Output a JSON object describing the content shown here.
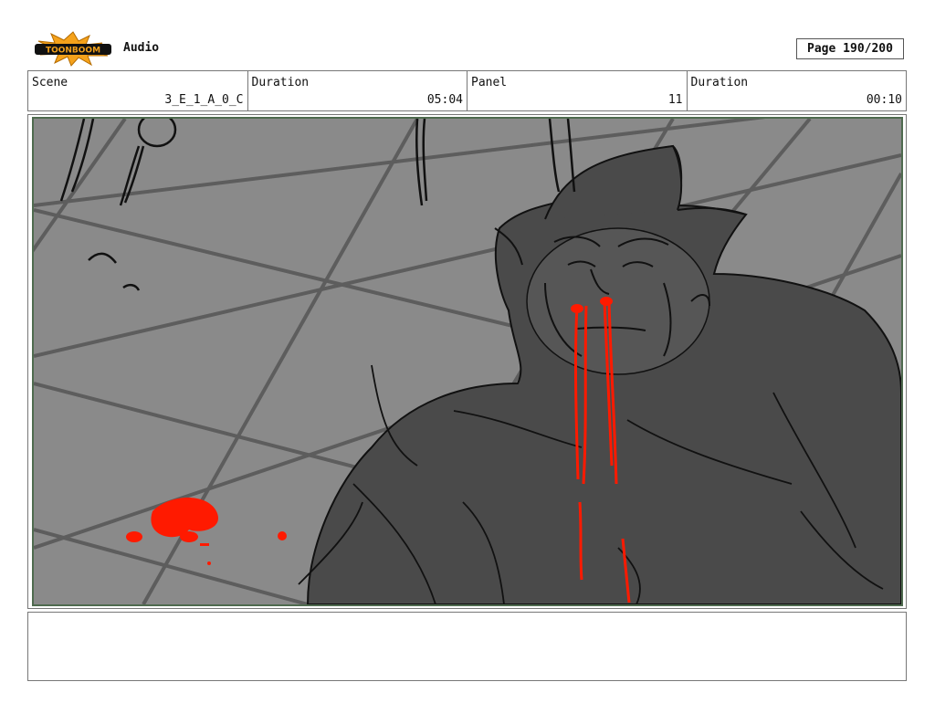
{
  "header": {
    "logo_text": "TOONBOOM",
    "audio_label": "Audio",
    "page_label": "Page 190/200"
  },
  "info": {
    "scene_label": "Scene",
    "scene_value": "3_E_1_A_0_C",
    "duration_label": "Duration",
    "duration_value": "05:04",
    "panel_label": "Panel",
    "panel_value": "11",
    "panel_duration_label": "Duration",
    "panel_duration_value": "00:10"
  },
  "notes": {
    "text": ""
  },
  "colors": {
    "panel_border": "#4f6b4f",
    "floor": "#8a8a8a",
    "character": "#4a4a4a",
    "blood": "#ff1a00",
    "logo_orange": "#f5a21b"
  }
}
